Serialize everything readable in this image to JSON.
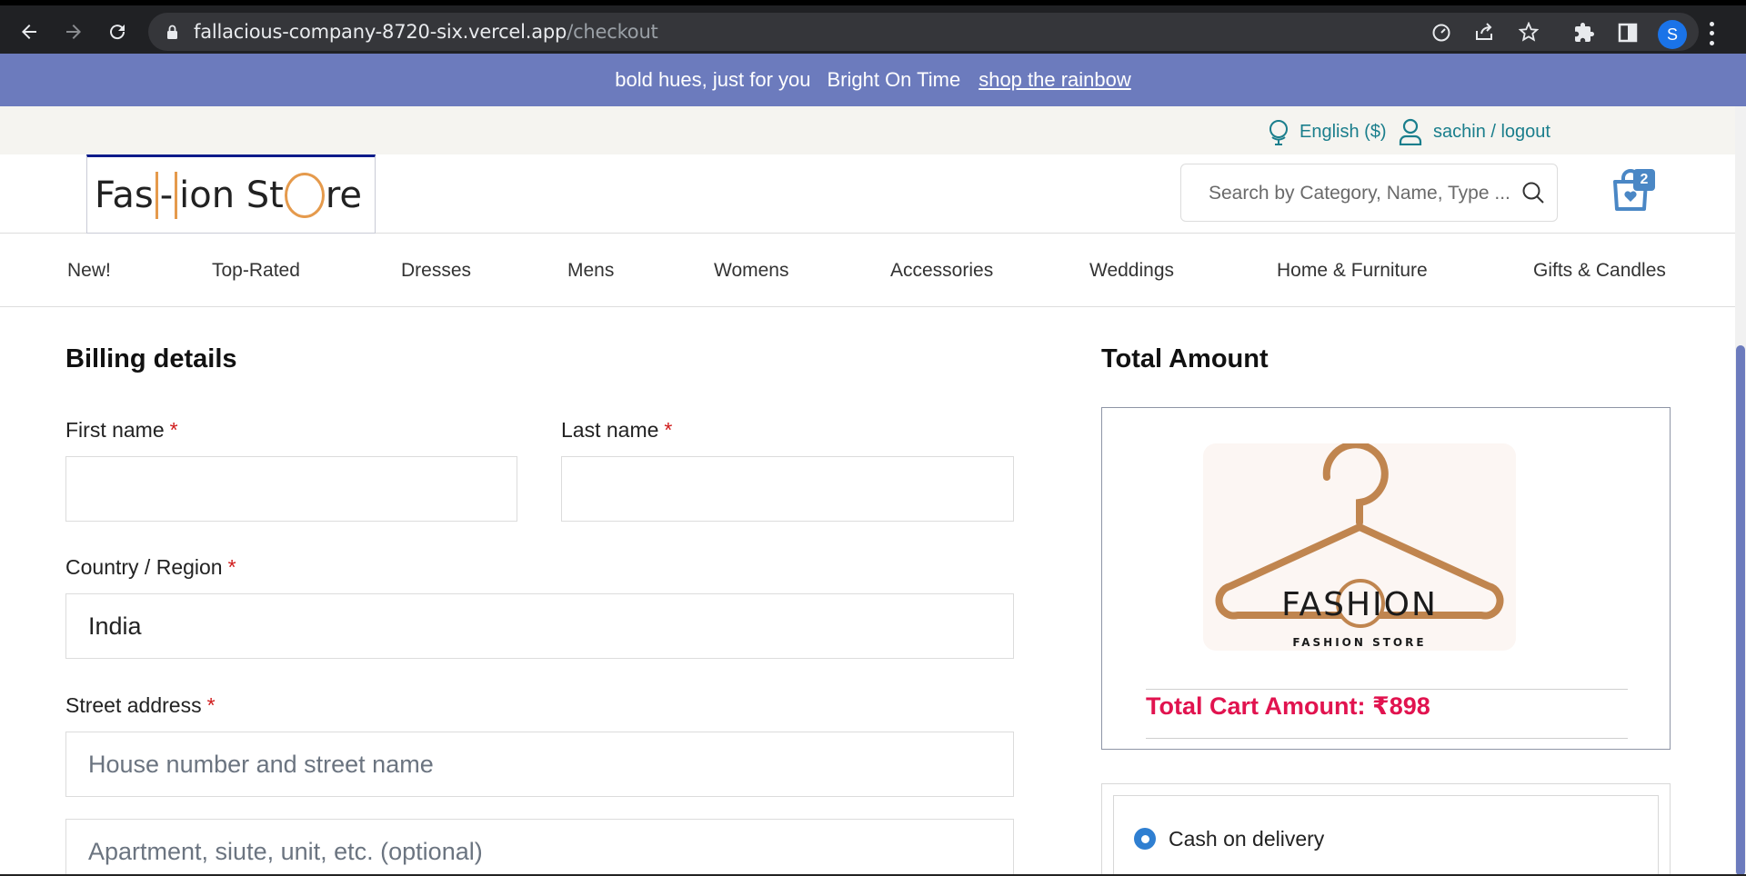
{
  "browser": {
    "url_host": "fallacious-company-8720-six.vercel.app",
    "url_path": "/checkout",
    "profile_initial": "S"
  },
  "announcement": {
    "text1": "bold hues, just for you",
    "text2": "Bright On Time",
    "link": "shop the rainbow"
  },
  "util": {
    "language": "English ($)",
    "user": "sachin / logout"
  },
  "header": {
    "logo_part1": "Fas",
    "logo_part2": "-",
    "logo_part3": "ion St",
    "logo_part4": "re",
    "search_placeholder": "Search by Category, Name, Type ...",
    "cart_count": "2"
  },
  "nav": [
    "New!",
    "Top-Rated",
    "Dresses",
    "Mens",
    "Womens",
    "Accessories",
    "Weddings",
    "Home & Furniture",
    "Gifts & Candles"
  ],
  "billing": {
    "title": "Billing details",
    "first_name_label": "First name",
    "last_name_label": "Last name",
    "country_label": "Country / Region",
    "country_value": "India",
    "street_label": "Street address",
    "street_placeholder": "House number and street name",
    "apt_placeholder": "Apartment, siute, unit, etc. (optional)",
    "required_mark": "*"
  },
  "total": {
    "title": "Total Amount",
    "logo_word_left": "FAS",
    "logo_word_mid": "H",
    "logo_word_right": "ION",
    "logo_tagline": "FASHION STORE",
    "cart_amount": "Total Cart Amount: ₹898"
  },
  "payment": {
    "option": "Cash on delivery"
  },
  "colors": {
    "announce_bg": "#6c7bbd",
    "accent_teal": "#1a7e8c",
    "total_red": "#e1134f",
    "logo_orange": "#e59a4c",
    "hanger_brown": "#c0854f"
  }
}
